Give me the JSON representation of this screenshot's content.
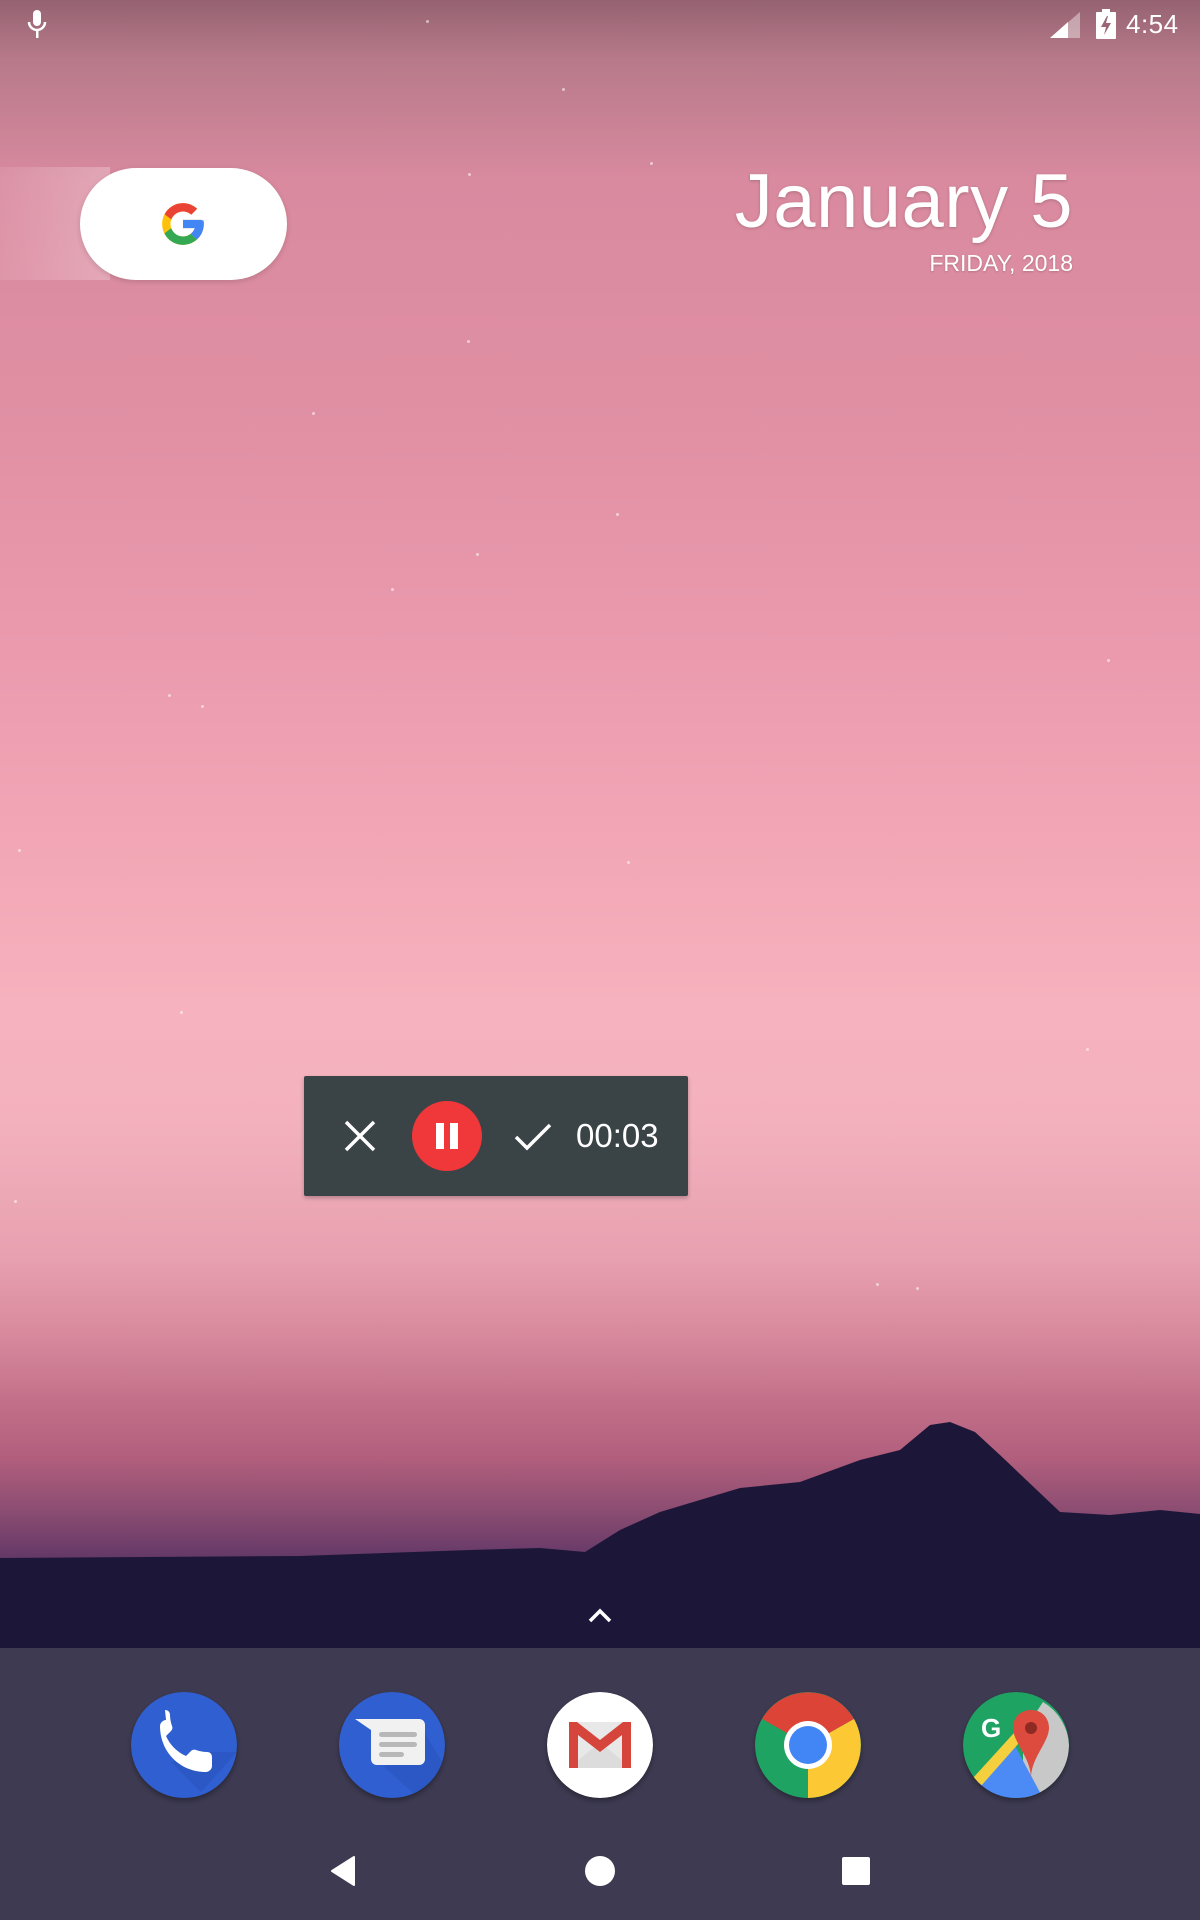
{
  "status_bar": {
    "left_icons": [
      "mic-icon"
    ],
    "right_icons": [
      "cellular-signal-icon",
      "battery-charging-icon"
    ],
    "time": "4:54"
  },
  "search_widget": {
    "icon": "google-g-logo"
  },
  "date_widget": {
    "date": "January 5",
    "weekday_year": "FRIDAY, 2018"
  },
  "screen_recorder": {
    "cancel_icon": "close-icon",
    "pause_icon": "pause-icon",
    "done_icon": "check-icon",
    "elapsed": "00:03",
    "accent_color": "#f0373a",
    "panel_color": "#3a4346"
  },
  "app_drawer_handle": {
    "icon": "chevron-up-icon"
  },
  "dock": {
    "apps": [
      {
        "name": "Phone",
        "icon": "phone-icon"
      },
      {
        "name": "Messages",
        "icon": "messages-icon"
      },
      {
        "name": "Gmail",
        "icon": "gmail-icon"
      },
      {
        "name": "Chrome",
        "icon": "chrome-icon"
      },
      {
        "name": "Maps",
        "icon": "maps-icon"
      }
    ]
  },
  "nav_bar": {
    "buttons": [
      {
        "name": "Back",
        "icon": "back-icon"
      },
      {
        "name": "Home",
        "icon": "home-icon"
      },
      {
        "name": "Recents",
        "icon": "recents-icon"
      }
    ]
  }
}
